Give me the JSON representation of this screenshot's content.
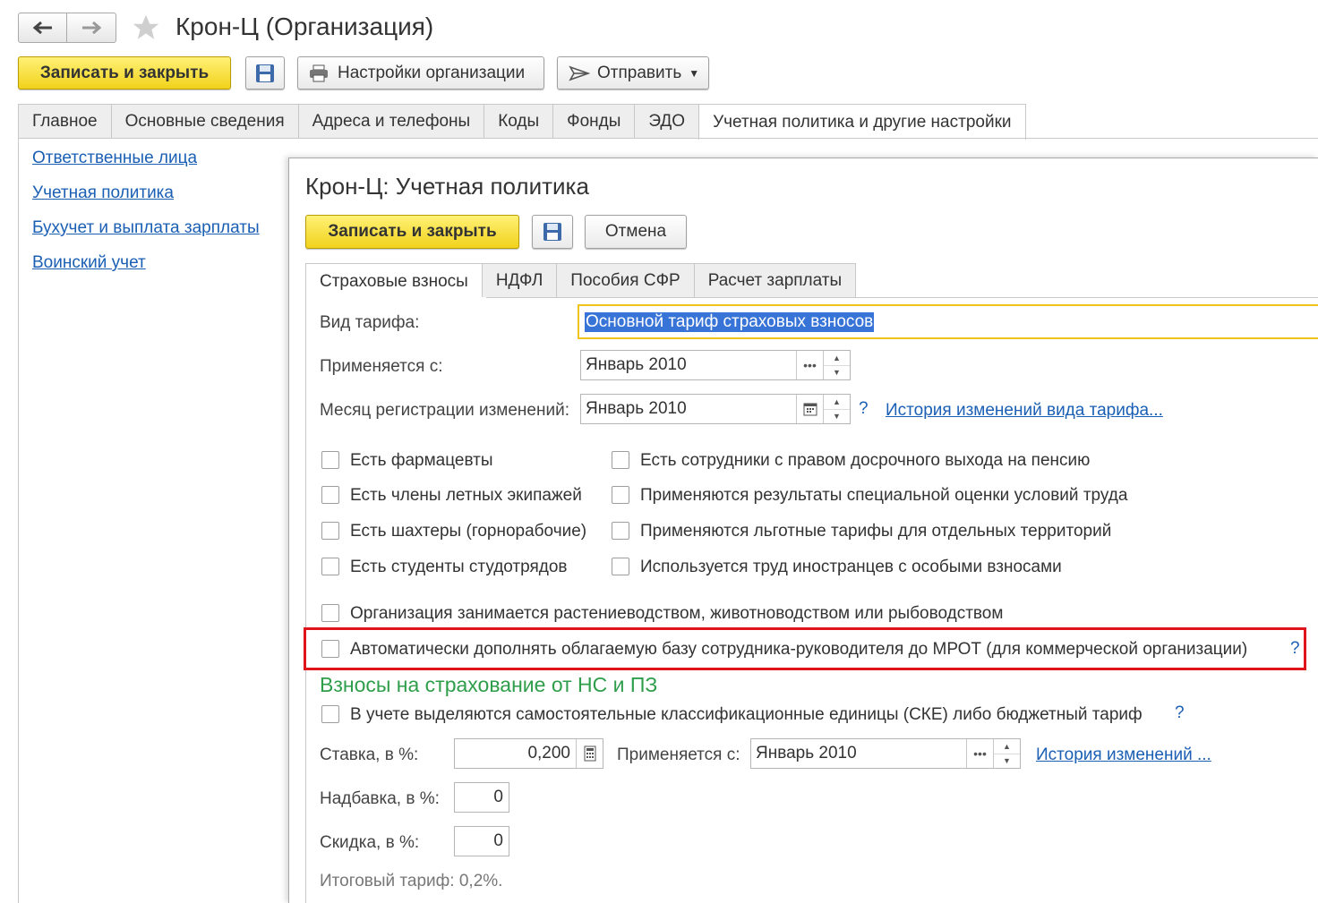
{
  "window": {
    "title": "Крон-Ц (Организация)"
  },
  "toolbar": {
    "save_close": "Записать и закрыть",
    "org_settings": "Настройки организации",
    "send": "Отправить"
  },
  "main_tabs": [
    {
      "label": "Главное"
    },
    {
      "label": "Основные сведения"
    },
    {
      "label": "Адреса и телефоны"
    },
    {
      "label": "Коды"
    },
    {
      "label": "Фонды"
    },
    {
      "label": "ЭДО"
    },
    {
      "label": "Учетная политика и другие настройки"
    }
  ],
  "sidebar": {
    "links": [
      {
        "label": "Ответственные лица"
      },
      {
        "label": "Учетная политика"
      },
      {
        "label": "Бухучет и выплата зарплаты"
      },
      {
        "label": "Воинский учет"
      }
    ]
  },
  "dialog": {
    "title": "Крон-Ц: Учетная политика",
    "save_close": "Записать и закрыть",
    "cancel": "Отмена",
    "tabs": [
      {
        "label": "Страховые взносы"
      },
      {
        "label": "НДФЛ"
      },
      {
        "label": "Пособия СФР"
      },
      {
        "label": "Расчет зарплаты"
      }
    ],
    "form": {
      "tariff_label": "Вид тарифа:",
      "tariff_value": "Основной тариф страховых взносов",
      "applies_label": "Применяется с:",
      "applies_value": "Январь 2010",
      "reg_month_label": "Месяц регистрации изменений:",
      "reg_month_value": "Январь 2010",
      "history_link": "История изменений вида тарифа...",
      "help": "?"
    },
    "checkboxes_left": [
      {
        "label": "Есть фармацевты",
        "checked": false
      },
      {
        "label": "Есть члены летных экипажей",
        "checked": false
      },
      {
        "label": "Есть шахтеры (горнорабочие)",
        "checked": false
      },
      {
        "label": "Есть студенты студотрядов",
        "checked": false
      }
    ],
    "checkboxes_right": [
      {
        "label": "Есть сотрудники с правом досрочного выхода на пенсию",
        "checked": false
      },
      {
        "label": "Применяются результаты специальной оценки условий труда",
        "checked": false
      },
      {
        "label": "Применяются льготные тарифы для отдельных территорий",
        "checked": false
      },
      {
        "label": "Используется труд иностранцев с особыми взносами",
        "checked": false
      }
    ],
    "agri_checkbox": "Организация занимается растениеводством, животноводством или рыбоводством",
    "mrot_checkbox": "Автоматически дополнять облагаемую базу сотрудника-руководителя до МРОТ (для коммерческой организации)",
    "ns_section": {
      "title": "Взносы на страхование от НС и ПЗ",
      "ske_checkbox": "В учете выделяются самостоятельные классификационные единицы (СКЕ) либо бюджетный тариф",
      "rate_label": "Ставка, в %:",
      "rate_value": "0,200",
      "applies_label": "Применяется с:",
      "applies_value": "Январь 2010",
      "history_link": "История изменений ...",
      "surcharge_label": "Надбавка, в %:",
      "surcharge_value": "0",
      "discount_label": "Скидка, в %:",
      "discount_value": "0",
      "total": "Итоговый тариф: 0,2%."
    }
  },
  "colors": {
    "accent_yellow": "#f1d21b",
    "link_blue": "#1a5fb4",
    "section_green": "#2e9e4a",
    "highlight_red": "#e0151b",
    "selection_blue": "#3874d8"
  }
}
